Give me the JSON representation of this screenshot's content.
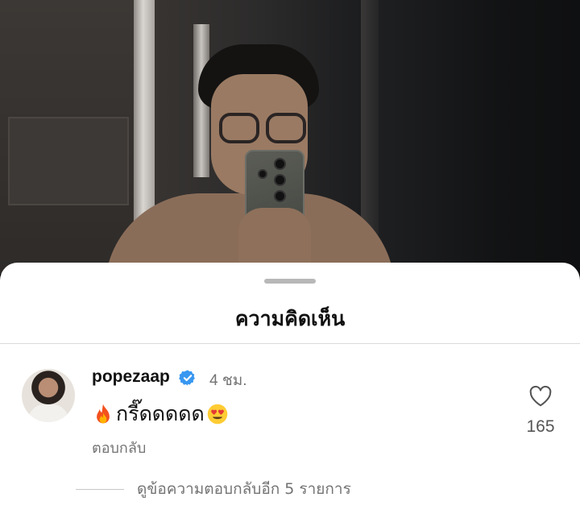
{
  "sheet": {
    "title": "ความคิดเห็น"
  },
  "comment": {
    "username": "popezaap",
    "verified_icon": "verified-badge-icon",
    "time": "4 ชม.",
    "text": "กรี๊ดดดดด",
    "leading_emoji": "fire-emoji",
    "trailing_emoji": "heart-eyes-emoji",
    "reply_label": "ตอบกลับ",
    "like_count": "165",
    "like_icon": "heart-outline-icon"
  },
  "replies": {
    "view_label": "ดูข้อความตอบกลับอีก 5 รายการ"
  },
  "colors": {
    "verified_blue": "#3897f0",
    "muted_text": "#737373",
    "primary_text": "#111111"
  }
}
